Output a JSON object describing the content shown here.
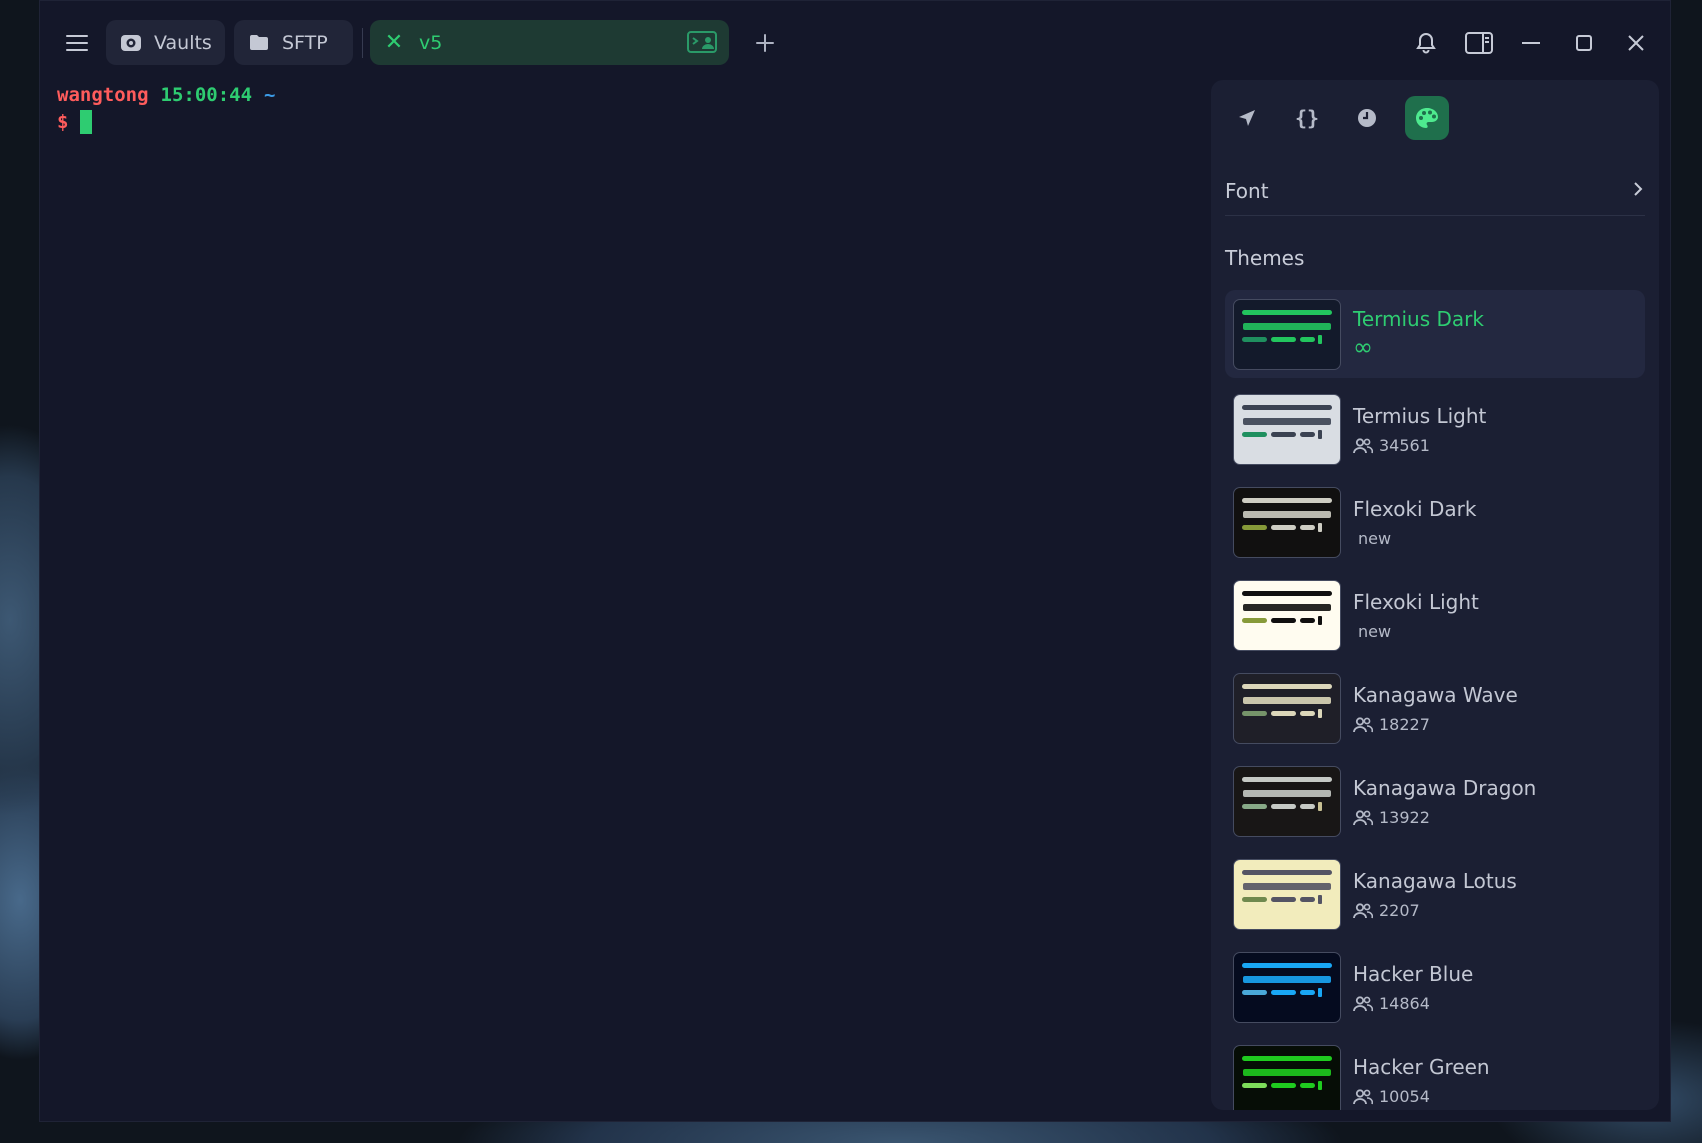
{
  "tabs": {
    "vaults_label": "Vaults",
    "sftp_label": "SFTP",
    "active_label": "v5"
  },
  "terminal": {
    "user": "wangtong",
    "time": "15:00:44",
    "path": "~",
    "prompt": "$"
  },
  "panel": {
    "font_label": "Font",
    "themes_title": "Themes",
    "themes": [
      {
        "name": "Termius Dark",
        "meta": "∞",
        "meta_kind": "infinity"
      },
      {
        "name": "Termius Light",
        "meta": "34561",
        "meta_kind": "users"
      },
      {
        "name": "Flexoki Dark",
        "meta": "new",
        "meta_kind": "new"
      },
      {
        "name": "Flexoki Light",
        "meta": "new",
        "meta_kind": "new"
      },
      {
        "name": "Kanagawa Wave",
        "meta": "18227",
        "meta_kind": "users"
      },
      {
        "name": "Kanagawa Dragon",
        "meta": "13922",
        "meta_kind": "users"
      },
      {
        "name": "Kanagawa Lotus",
        "meta": "2207",
        "meta_kind": "users"
      },
      {
        "name": "Hacker Blue",
        "meta": "14864",
        "meta_kind": "users"
      },
      {
        "name": "Hacker Green",
        "meta": "10054",
        "meta_kind": "users"
      }
    ]
  },
  "colors": {
    "accent": "#2ecc71",
    "window_bg": "#141729",
    "panel_bg": "#1b1f33"
  }
}
